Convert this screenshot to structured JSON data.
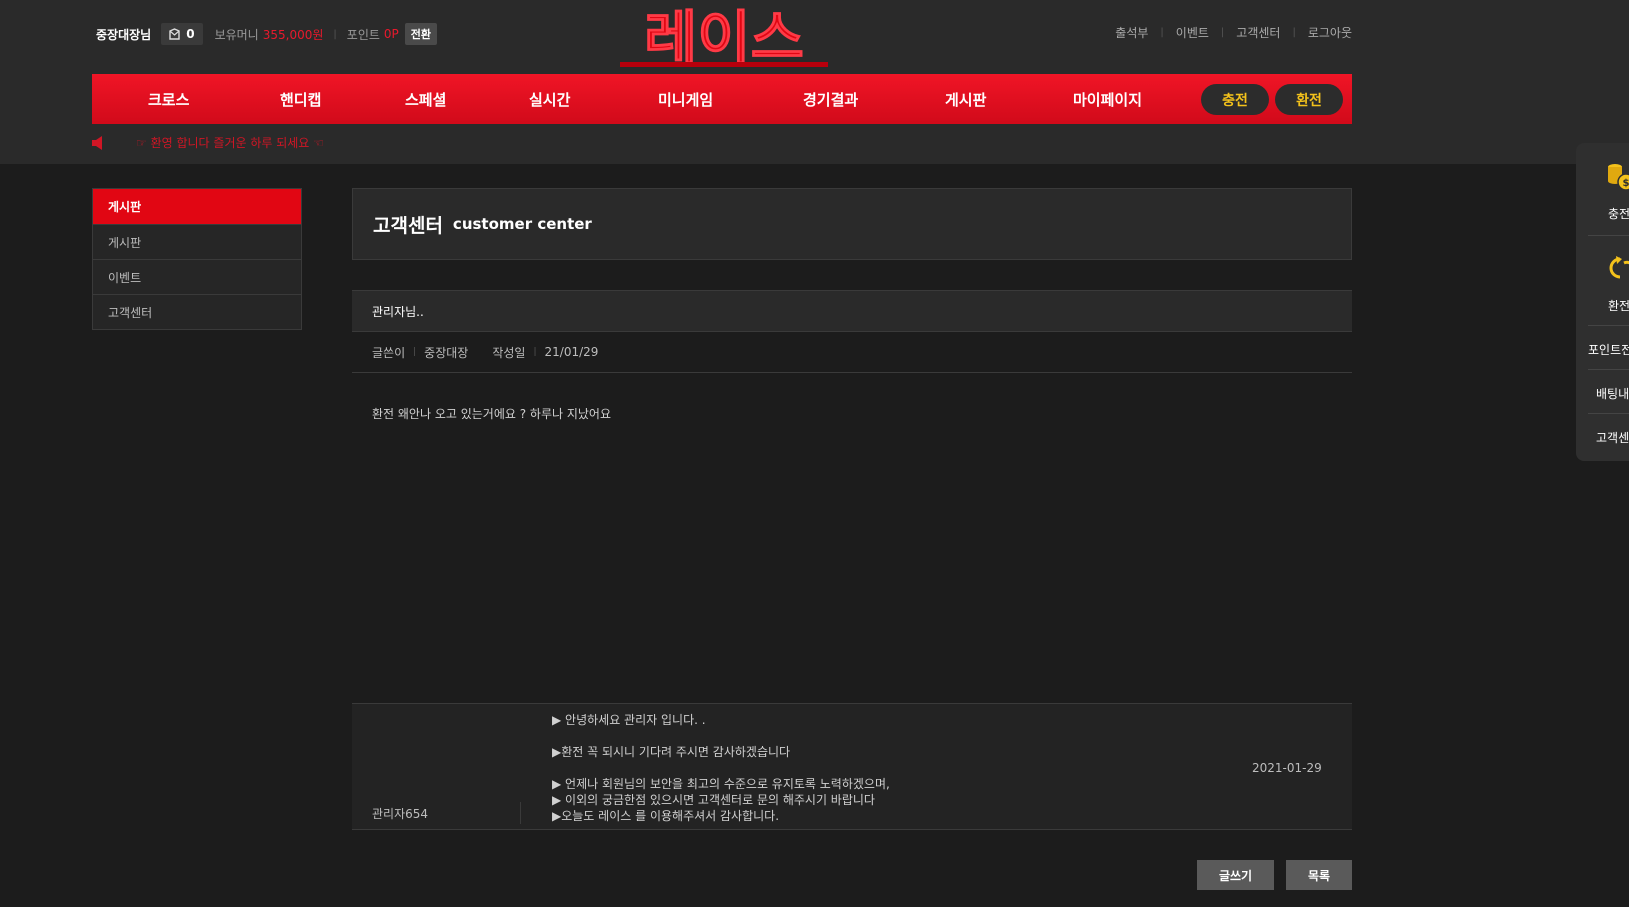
{
  "user": {
    "name": "중장대장님",
    "message_count": "0",
    "money_label": "보유머니",
    "money_value": "355,000원",
    "point_label": "포인트",
    "point_value": "0P",
    "convert_label": "전환"
  },
  "logo": {
    "text": "레이스",
    "color": "#e10613"
  },
  "top_links": [
    "출석부",
    "이벤트",
    "고객센터",
    "로그아웃"
  ],
  "nav": {
    "items": [
      "크로스",
      "핸디캡",
      "스페셜",
      "실시간",
      "미니게임",
      "경기결과",
      "게시판",
      "마이페이지"
    ],
    "charge_label": "충전",
    "exchange_label": "환전"
  },
  "notice": {
    "text": "☞ 환영 합니다 즐거운 하루 되세요 ☜"
  },
  "sidebar": {
    "header": "게시판",
    "items": [
      "게시판",
      "이벤트",
      "고객센터"
    ]
  },
  "page": {
    "title_ko": "고객센터",
    "title_en": "customer center"
  },
  "post": {
    "title": "관리자님..",
    "author_label": "글쓴이",
    "author": "중장대장",
    "date_label": "작성일",
    "date": "21/01/29",
    "body": "환전 왜안나 오고 있는거에요 ? 하루나 지났어요"
  },
  "reply": {
    "author": "관리자654",
    "lines": [
      "▶ 안녕하세요 관리자 입니다. .",
      "▶환전 꼭 되시니 기다려 주시면 감사하겠습니다",
      "▶ 언제나 회원님의 보안을 최고의 수준으로 유지토록 노력하겠으며,",
      "▶ 이외의 궁금한점 있으시면 고객센터로 문의 해주시기 바랍니다",
      "▶오늘도 레이스 를 이용해주셔서 감사합니다."
    ],
    "date": "2021-01-29"
  },
  "buttons": {
    "write_label": "글쓰기",
    "list_label": "목록"
  },
  "quick_menu": {
    "charge_label": "충전",
    "exchange_label": "환전",
    "point_label": "포인트전",
    "betting_label": "배팅내",
    "support_label": "고객센"
  },
  "colors": {
    "accent": "#e10613",
    "gold": "#f4c21b",
    "background": "#1c1c1c"
  }
}
